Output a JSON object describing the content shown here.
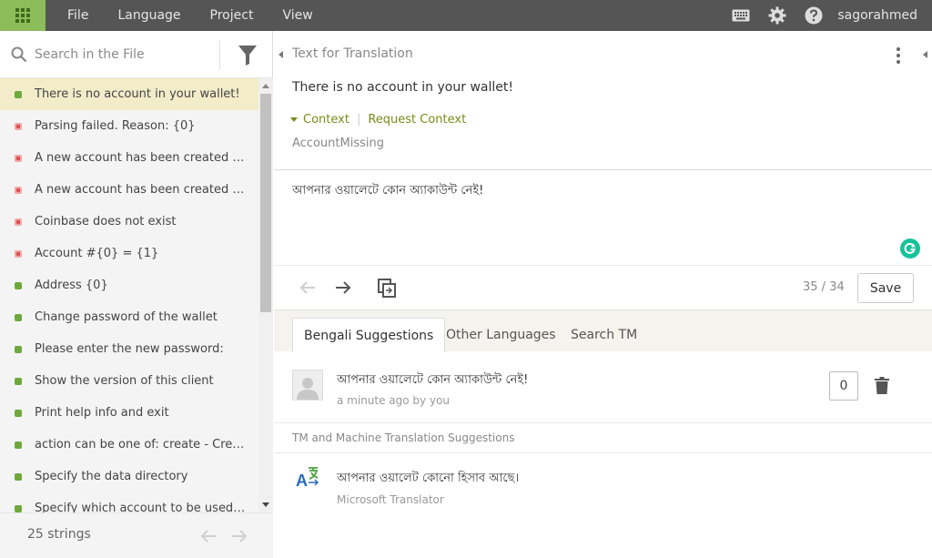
{
  "topbar": {
    "menu": [
      "File",
      "Language",
      "Project",
      "View"
    ],
    "username": "sagorahmed",
    "icons": [
      "apps-grid-icon",
      "keyboard-icon",
      "gear-icon",
      "help-icon"
    ]
  },
  "sidebar": {
    "search_placeholder": "Search in the File",
    "items": [
      {
        "text": "There is no account in your wallet!",
        "status": "translated",
        "selected": true
      },
      {
        "text": "Parsing failed. Reason: {0}",
        "status": "untranslated"
      },
      {
        "text": "A new account has been created and ...",
        "status": "untranslated"
      },
      {
        "text": "A new account has been created for ...",
        "status": "untranslated"
      },
      {
        "text": "Coinbase does not exist",
        "status": "untranslated"
      },
      {
        "text": "Account #{0} = {1}",
        "status": "untranslated"
      },
      {
        "text": "Address {0}",
        "status": "translated"
      },
      {
        "text": "Change password of the wallet",
        "status": "translated"
      },
      {
        "text": "Please enter the new password:",
        "status": "translated"
      },
      {
        "text": "Show the version of this client",
        "status": "translated"
      },
      {
        "text": "Print help info and exit",
        "status": "translated"
      },
      {
        "text": "action can be one of: create - Create ...",
        "status": "translated"
      },
      {
        "text": "Specify the data directory",
        "status": "translated"
      },
      {
        "text": "Specify which account to be used as",
        "status": "translated"
      }
    ],
    "footer": {
      "count": "25 strings"
    }
  },
  "editor": {
    "source_heading": "Text for Translation",
    "source_text": "There is no account in your wallet!",
    "context_label": "Context",
    "request_context": "Request Context",
    "context_key": "AccountMissing",
    "translation": "আপনার ওয়ালেটে কোন অ্যাকাউন্ট নেই!",
    "counter": "35 / 34",
    "save_label": "Save"
  },
  "tabs": [
    "Bengali Suggestions",
    "Other Languages",
    "Search TM"
  ],
  "suggestions": {
    "user": {
      "text": "আপনার ওয়ালেটে কোন অ্যাকাউন্ট নেই!",
      "meta": "a minute ago by you",
      "votes": "0"
    },
    "tm_section_label": "TM and Machine Translation Suggestions",
    "machine": {
      "text": "আপনার ওয়ালেট কোনো হিসাব আছে।",
      "source": "Microsoft Translator"
    }
  },
  "colors": {
    "accent": "#8dbc5a",
    "topbar": "#555555",
    "selected": "#f2ecc9",
    "translated": "#6fa83f",
    "untranslated": "#d95050",
    "context": "#7a8b1b"
  }
}
